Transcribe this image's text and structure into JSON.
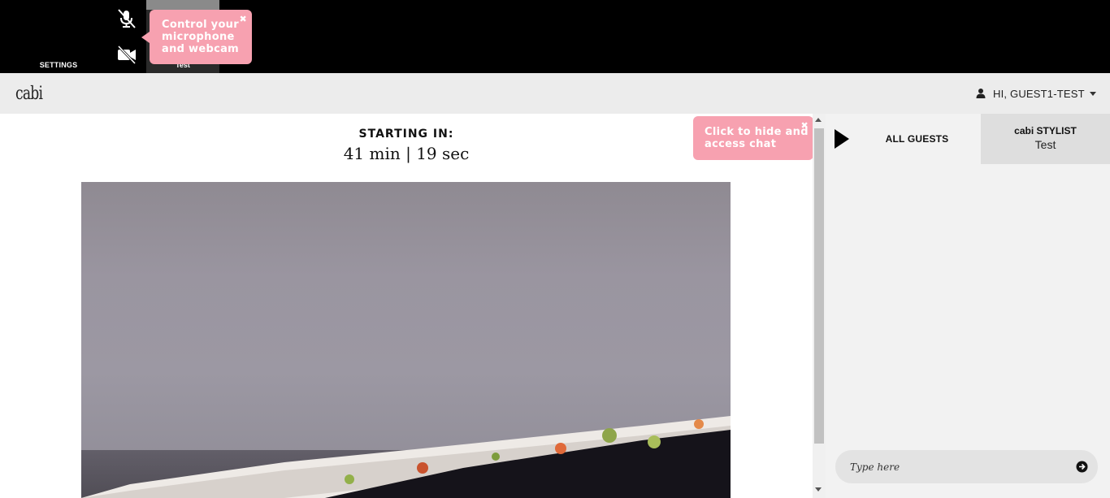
{
  "topbar": {
    "settings_label": "SETTINGS",
    "participant_label": "Test",
    "mic_icon": "mic-off-icon",
    "cam_icon": "camera-off-icon"
  },
  "tips": {
    "media_tip": "Control your microphone and webcam",
    "chat_tip": "Click to hide and access chat",
    "close_glyph": "✖"
  },
  "header": {
    "logo": "cabi",
    "user_label": "HI, GUEST1-TEST"
  },
  "main": {
    "starting_label": "STARTING IN:",
    "countdown": "41 min | 19 sec"
  },
  "chat": {
    "tab_all_guests": "ALL GUESTS",
    "tab_stylist_title": "cabi STYLIST",
    "tab_stylist_name": "Test",
    "input_placeholder": "Type here"
  },
  "colors": {
    "tooltip_pink": "#f7a1b0",
    "topbar_bg": "#000000",
    "header_bg": "#ececec",
    "chat_bg": "#f2f2f2"
  }
}
